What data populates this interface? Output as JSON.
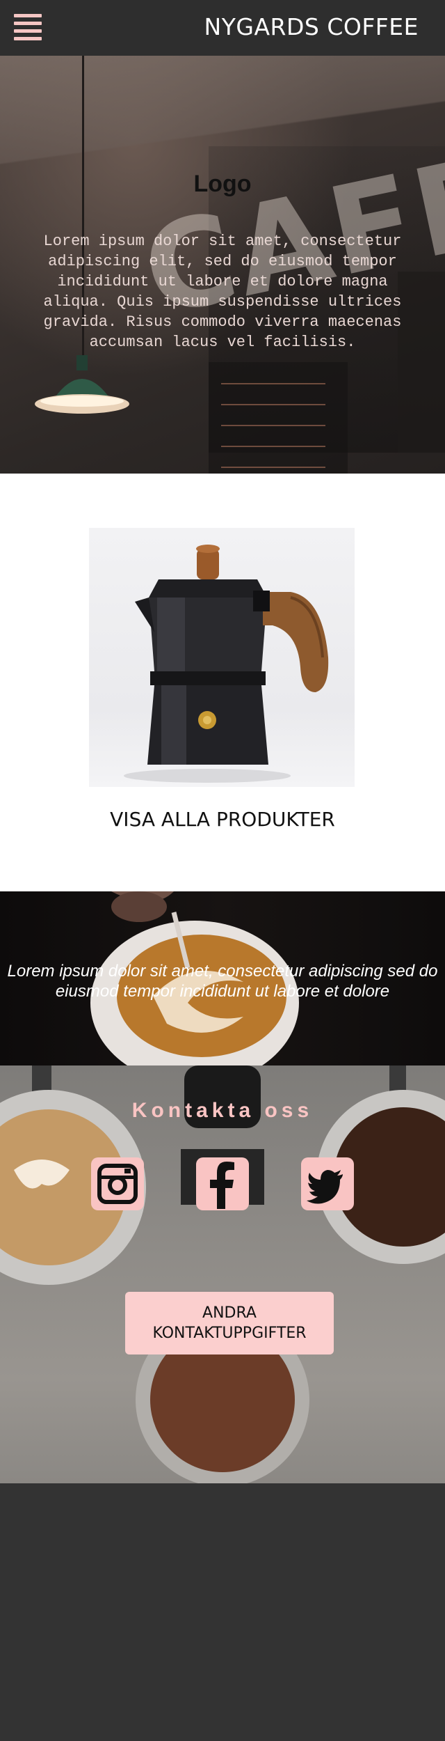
{
  "header": {
    "brand": "NYGARDS COFFEE",
    "menu_icon": "hamburger-menu-icon"
  },
  "hero": {
    "logo": "Logo",
    "sign_text": "CAFE",
    "lorem": "Lorem ipsum dolor sit amet, consectetur adipiscing elit, sed do eiusmod tempor incididunt ut labore et dolore magna aliqua. Quis ipsum suspendisse ultrices gravida. Risus commodo viverra maecenas accumsan lacus vel facilisis."
  },
  "product": {
    "show_all_label": "VISA ALLA PRODUKTER"
  },
  "banner": {
    "quote": "Lorem ipsum dolor sit amet, consectetur adipiscing sed do eiusmod tempor incididunt ut labore et dolore"
  },
  "contact": {
    "title": "Kontakta oss",
    "social": [
      "instagram-icon",
      "facebook-icon",
      "twitter-icon"
    ],
    "cta_label": "ANDRA KONTAKTUPPGIFTER"
  },
  "colors": {
    "accent_pink": "#f9c4c3",
    "topbar": "#2e2e2e",
    "footer": "#333333"
  }
}
